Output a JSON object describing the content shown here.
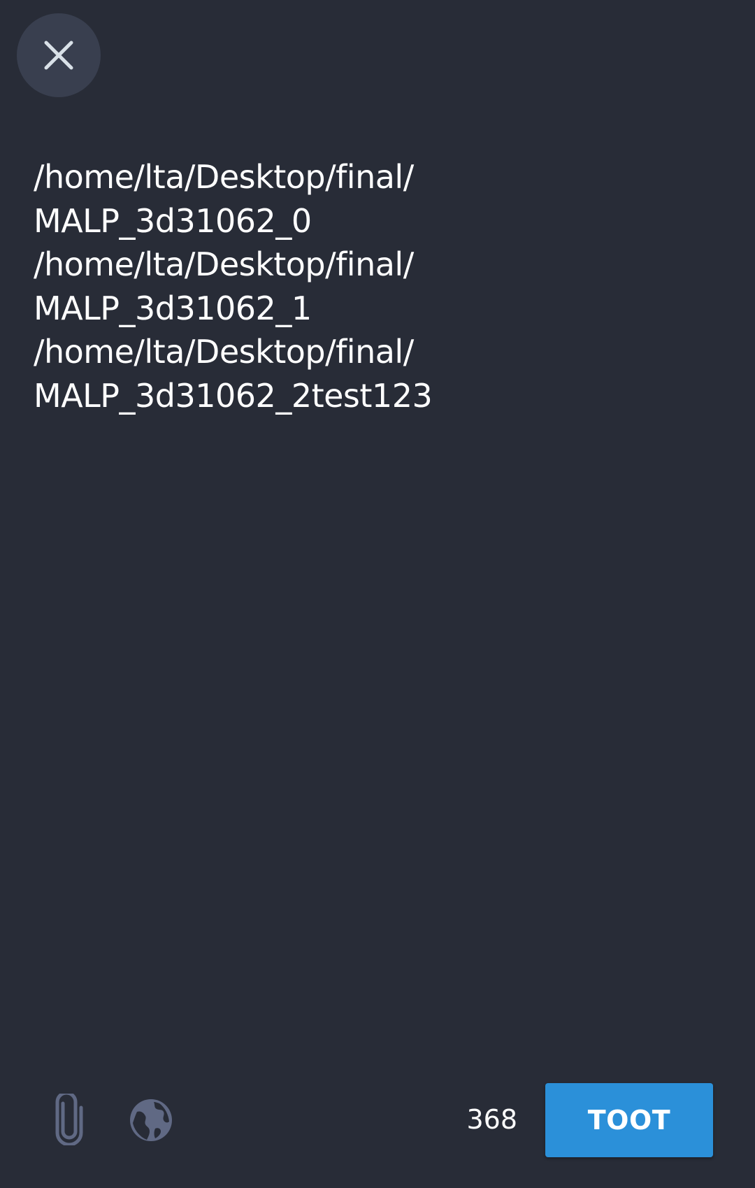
{
  "compose": {
    "lines": [
      "/home/lta/Desktop/final/",
      "MALP_3d31062_0",
      "/home/lta/Desktop/final/",
      "MALP_3d31062_1",
      "/home/lta/Desktop/final/",
      "MALP_3d31062_2test123"
    ]
  },
  "toolbar": {
    "close_icon": "close-icon",
    "attach_icon": "paperclip-icon",
    "visibility_icon": "globe-icon",
    "char_count": "368",
    "toot_label": "TOOT"
  },
  "colors": {
    "background": "#282c37",
    "close_button_bg": "#393f4f",
    "icon_color": "#606984",
    "accent": "#2b90d9",
    "text": "#ffffff"
  }
}
